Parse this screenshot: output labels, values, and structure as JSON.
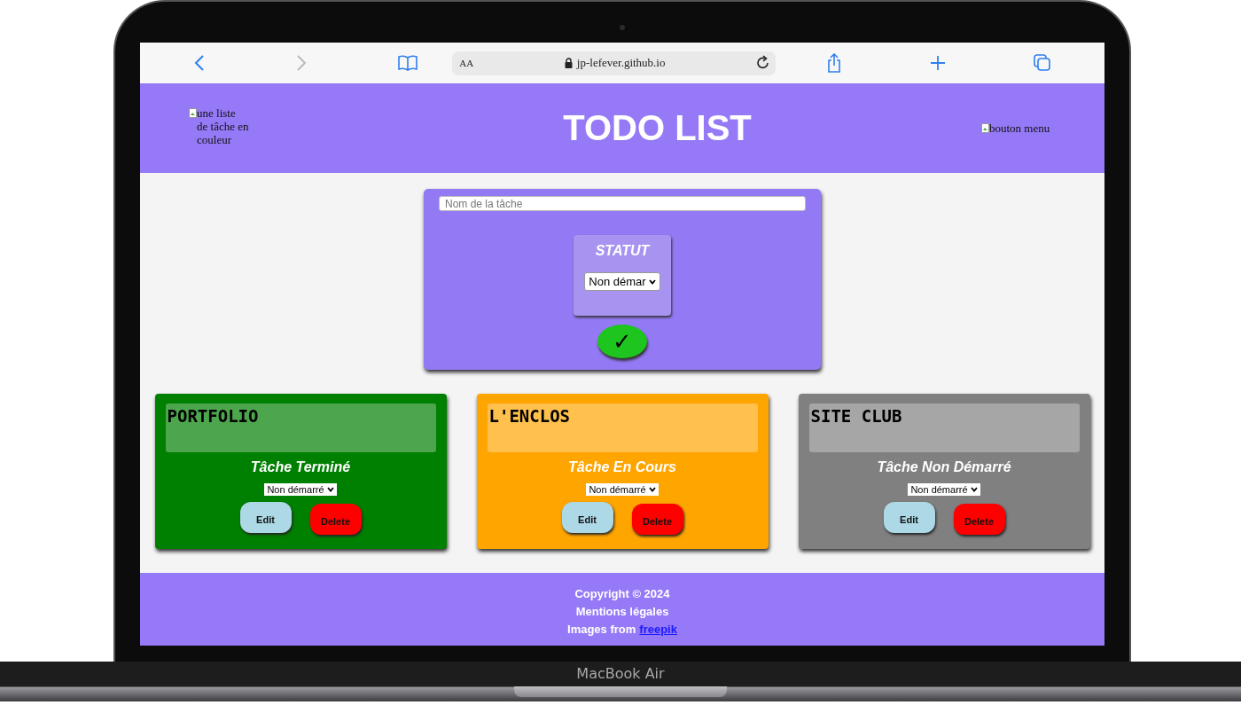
{
  "browser": {
    "text_size_button": "AA",
    "address": "jp-lefever.github.io"
  },
  "header": {
    "logo_alt": "une liste de tâche en couleur",
    "title": "TODO LIST",
    "menu_alt": "bouton menu"
  },
  "new_task": {
    "placeholder": "Nom de la tâche",
    "status_label": "STATUT",
    "status_value": "Non démar",
    "submit_symbol": "✓"
  },
  "tasks": [
    {
      "name": "PORTFOLIO",
      "status_label": "Tâche Terminé",
      "status_value": "Non démarré",
      "color": "#008000",
      "edit": "Edit",
      "delete": "Delete"
    },
    {
      "name": "L'ENCLOS",
      "status_label": "Tâche En Cours",
      "status_value": "Non démarré",
      "color": "#ffa500",
      "edit": "Edit",
      "delete": "Delete"
    },
    {
      "name": "SITE CLUB",
      "status_label": "Tâche Non Démarré",
      "status_value": "Non démarré",
      "color": "#808080",
      "edit": "Edit",
      "delete": "Delete"
    }
  ],
  "footer": {
    "lines": [
      "Copyright © 2024",
      "Mentions légales"
    ],
    "credit_prefix": "Images from",
    "credit_link": "freepik"
  },
  "device": {
    "label": "MacBook Air"
  }
}
